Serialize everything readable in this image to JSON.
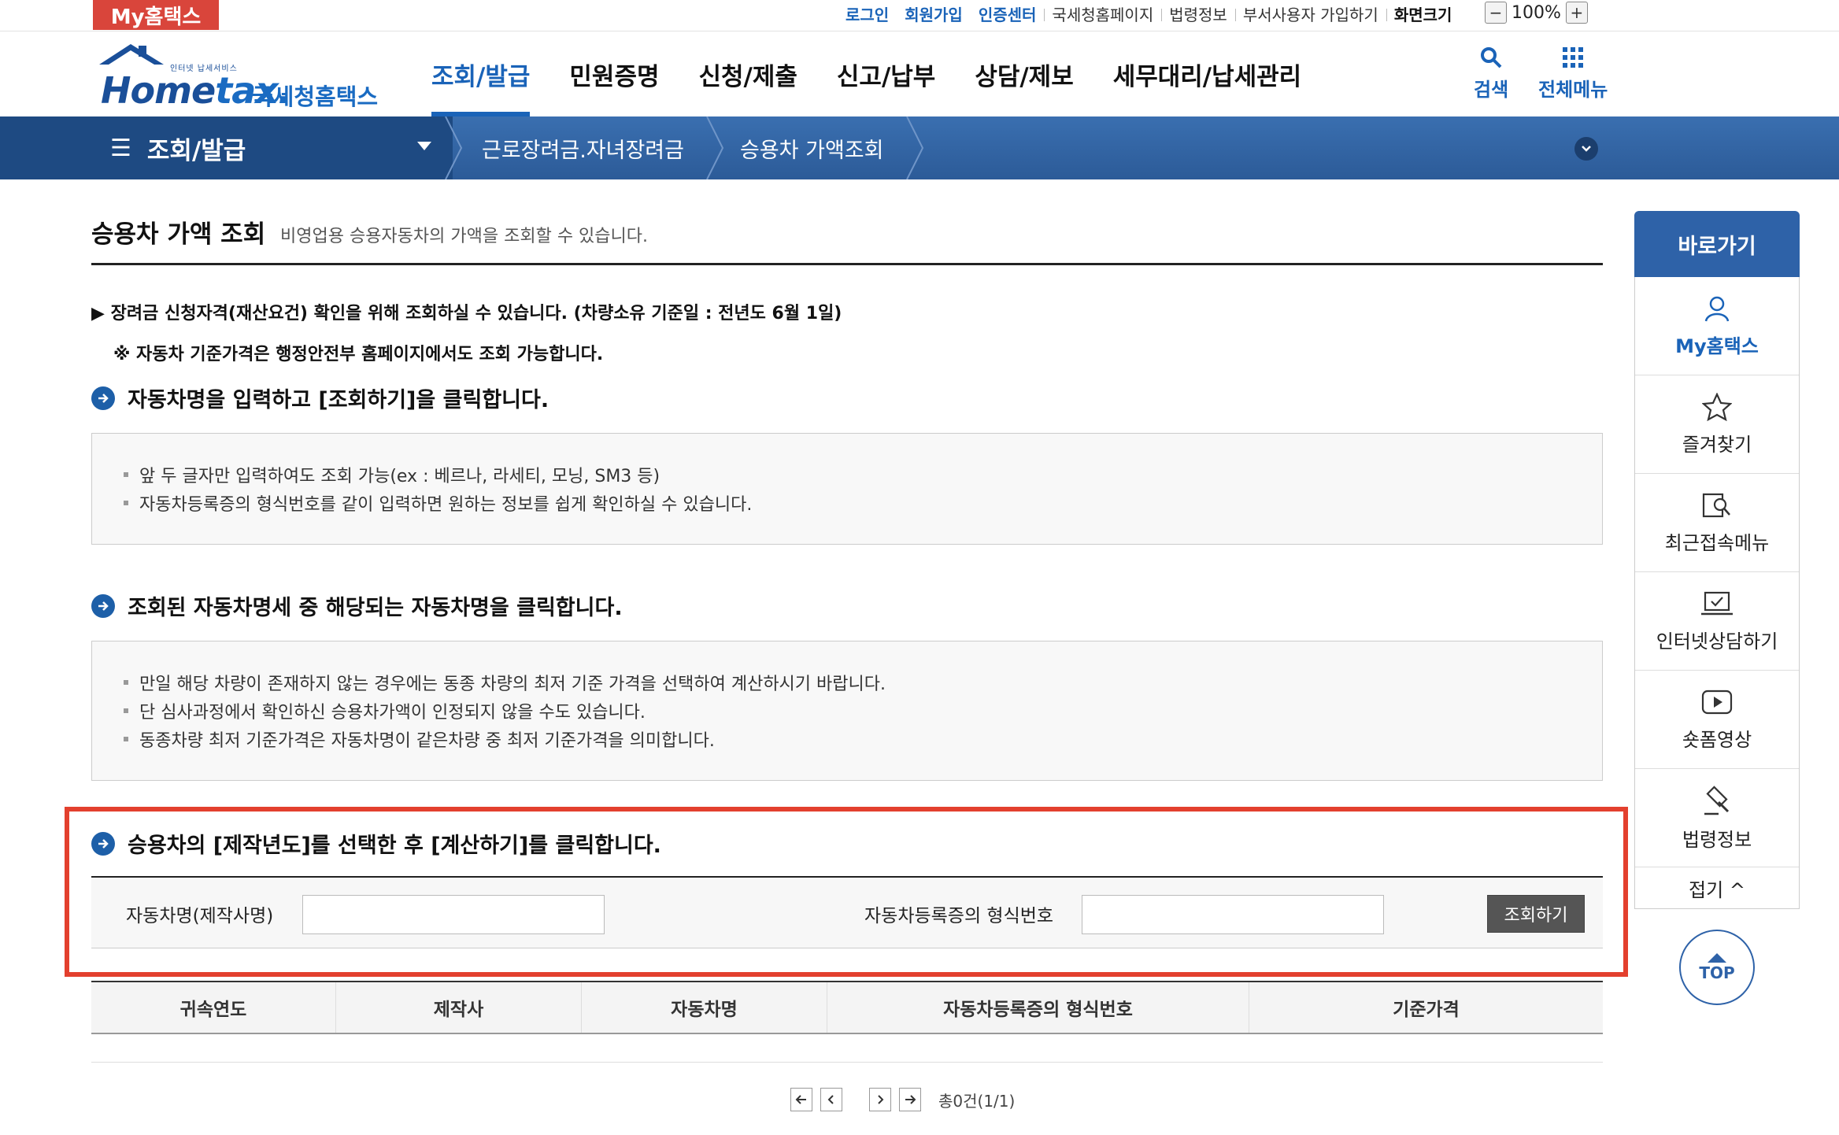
{
  "topbar": {
    "my_hometax": "My홈택스",
    "links": [
      "로그인",
      "회원가입",
      "인증센터",
      "국세청홈페이지",
      "법령정보",
      "부서사용자 가입하기",
      "화면크기"
    ],
    "zoom_minus": "−",
    "zoom_value": "100%",
    "zoom_plus": "+"
  },
  "header": {
    "logo_tagline": "인터넷 납세서비스",
    "logo_home": "Home",
    "logo_tax": "tax.",
    "logo_kname": "국세청홈택스",
    "gnb": [
      "조회/발급",
      "민원증명",
      "신청/제출",
      "신고/납부",
      "상담/제보",
      "세무대리/납세관리"
    ],
    "search_label": "검색",
    "allmenu_label": "전체메뉴"
  },
  "navbar": {
    "home_label": "조회/발급",
    "crumb1": "근로장려금.자녀장려금",
    "crumb2": "승용차 가액조회"
  },
  "page": {
    "title": "승용차 가액 조회",
    "desc": "비영업용 승용자동차의 가액을 조회할 수 있습니다.",
    "notice1": "▶ 장려금 신청자격(재산요건) 확인을 위해 조회하실 수 있습니다. (차량소유 기준일 : 전년도 6월 1일)",
    "notice2": "※ 자동차 기준가격은 행정안전부 홈페이지에서도 조회 가능합니다."
  },
  "steps": [
    {
      "title": "자동차명을 입력하고 [조회하기]을 클릭합니다.",
      "items": [
        "앞 두 글자만 입력하여도 조회 가능(ex : 베르나, 라세티, 모닝, SM3 등)",
        "자동차등록증의 형식번호를 같이 입력하면 원하는 정보를 쉽게 확인하실 수 있습니다."
      ]
    },
    {
      "title": "조회된 자동차명세 중 해당되는 자동차명을 클릭합니다.",
      "items": [
        "만일 해당 차량이 존재하지 않는 경우에는 동종 차량의 최저 기준 가격을 선택하여 계산하시기 바랍니다.",
        "단 심사과정에서 확인하신 승용차가액이 인정되지 않을 수도 있습니다.",
        "동종차량 최저 기준가격은 자동차명이 같은차량 중  최저 기준가격을 의미합니다."
      ]
    },
    {
      "title": "승용차의 [제작년도]를 선택한 후 [계산하기]를 클릭합니다."
    }
  ],
  "search": {
    "car_name_label": "자동차명(제작사명)",
    "car_name_value": "",
    "model_no_label": "자동차등록증의 형식번호",
    "model_no_value": "",
    "search_button": "조회하기"
  },
  "table": {
    "headers": [
      "귀속연도",
      "제작사",
      "자동차명",
      "자동차등록증의 형식번호",
      "기준가격"
    ]
  },
  "pager": {
    "total": "총0건(1/1)"
  },
  "quick": {
    "title": "바로가기",
    "items": [
      "My홈택스",
      "즐겨찾기",
      "최근접속메뉴",
      "인터넷상담하기",
      "숏폼영상",
      "법령정보"
    ],
    "fold": "접기 ^"
  },
  "top_button": "TOP",
  "colors": {
    "brand_blue": "#1a63b8",
    "nav_blue": "#2c5b98",
    "highlight_red": "#e3402e",
    "badge_red": "#d9453b"
  }
}
